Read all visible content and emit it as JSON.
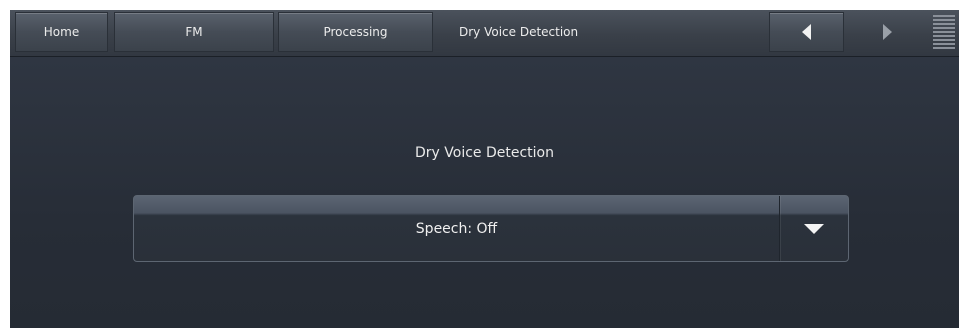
{
  "header": {
    "tabs": [
      {
        "label": "Home"
      },
      {
        "label": "FM"
      },
      {
        "label": "Processing"
      }
    ],
    "current_page": "Dry Voice Detection",
    "back_icon": "chevron-left-icon",
    "forward_icon": "chevron-right-icon",
    "menu_icon": "menu-icon"
  },
  "main": {
    "section_title": "Dry Voice Detection",
    "dropdown": {
      "value": "Speech: Off",
      "arrow_icon": "chevron-down-icon"
    }
  }
}
